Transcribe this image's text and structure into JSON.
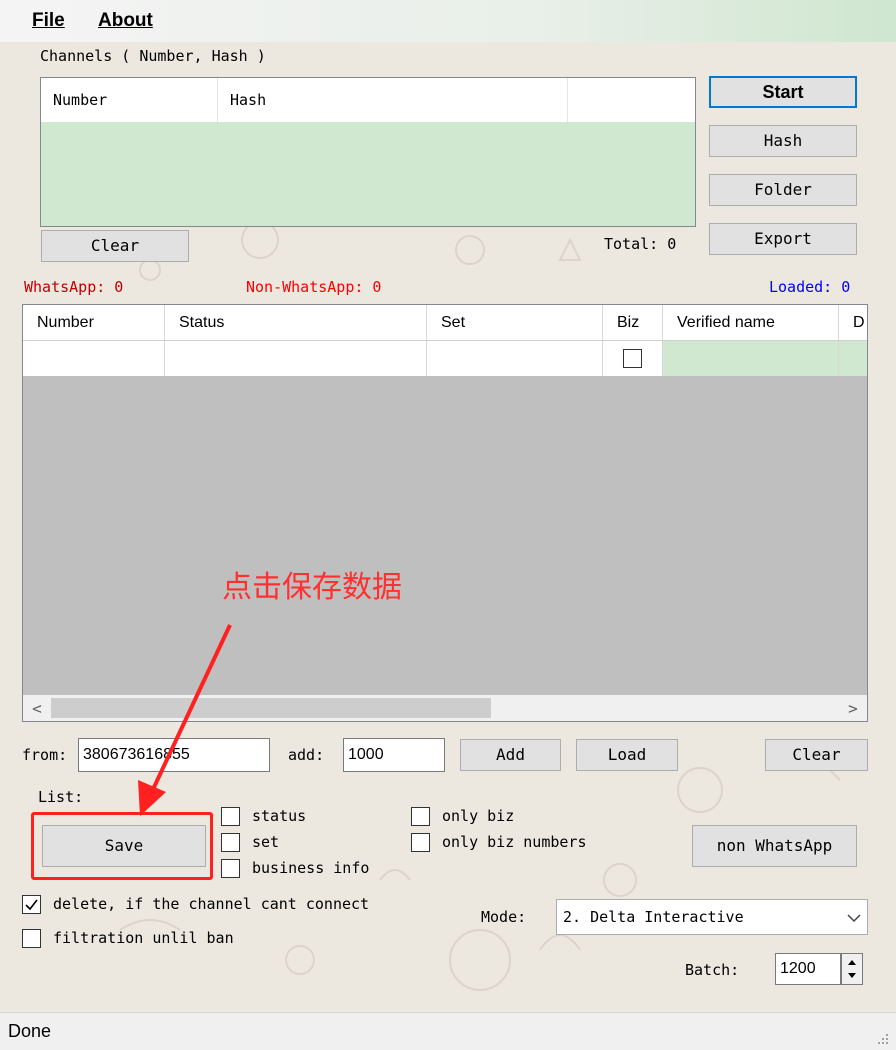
{
  "menu": {
    "file": "File",
    "about": "About"
  },
  "channels": {
    "group_label": "Channels ( Number, Hash )",
    "columns": [
      "Number",
      "Hash"
    ],
    "clear_label": "Clear",
    "total_label": "Total: 0"
  },
  "side_buttons": {
    "start": "Start",
    "hash": "Hash",
    "folder": "Folder",
    "export": "Export"
  },
  "counters": {
    "whatsapp": "WhatsApp: 0",
    "non_whatsapp": "Non-WhatsApp: 0",
    "loaded": "Loaded: 0"
  },
  "counter_colors": {
    "whatsapp": "#c00000",
    "non_whatsapp": "#ff0000",
    "loaded": "#0000ff"
  },
  "grid": {
    "columns": [
      "Number",
      "Status",
      "Set",
      "Biz",
      "Verified name",
      "D"
    ]
  },
  "range": {
    "from_label": "from:",
    "from_value": "380673616855",
    "add_label": "add:",
    "add_value": "1000",
    "add_button": "Add",
    "load_button": "Load",
    "clear_button": "Clear"
  },
  "list": {
    "label": "List:",
    "save_button": "Save",
    "checkboxes": {
      "status": "status",
      "set": "set",
      "business_info": "business info",
      "only_biz": "only biz",
      "only_biz_numbers": "only biz numbers"
    },
    "non_whatsapp_button": "non WhatsApp"
  },
  "options": {
    "delete_label": "delete, if the channel cant connect",
    "delete_checked": true,
    "filtration_label": "filtration unlil ban",
    "filtration_checked": false,
    "mode_label": "Mode:",
    "mode_value": "2. Delta Interactive",
    "batch_label": "Batch:",
    "batch_value": "1200"
  },
  "status_bar": {
    "text": "Done"
  },
  "annotation": {
    "text": "点击保存数据",
    "color": "#ff3030"
  }
}
